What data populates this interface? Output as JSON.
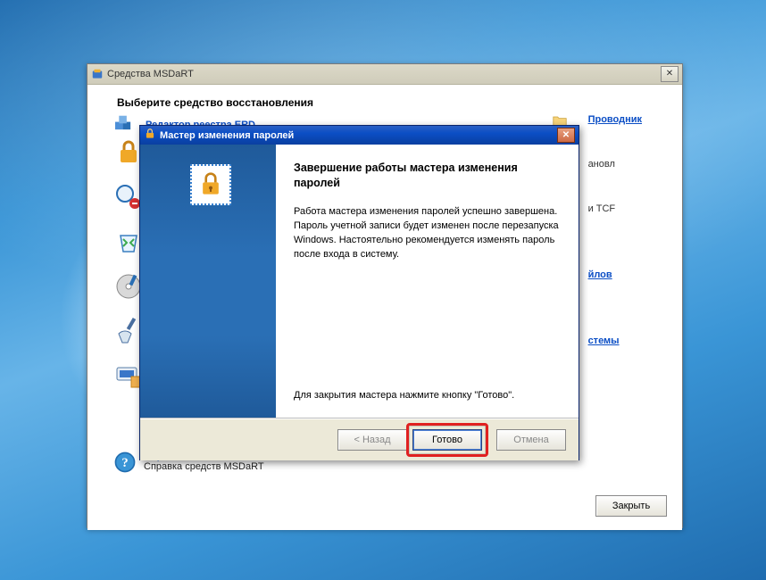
{
  "parent": {
    "title": "Средства MSDaRT",
    "heading": "Выберите средство восстановления",
    "tool_link": "Редактор реестра ERD",
    "right_link": "Проводник",
    "right_frag1": "ановл",
    "right_frag2": "и TCF",
    "right_frag3": "йлов",
    "right_frag4": "стемы",
    "help_link": "Справка",
    "help_desc": "Справка средств MSDaRT",
    "close_label": "Закрыть"
  },
  "wizard": {
    "title": "Мастер изменения паролей",
    "heading": "Завершение работы мастера изменения паролей",
    "paragraph": "Работа мастера изменения паролей успешно завершена. Пароль учетной записи будет изменен после перезапуска Windows. Настоятельно рекомендуется изменять пароль после входа в систему.",
    "hint": "Для закрытия мастера нажмите кнопку \"Готово\".",
    "back_label": "< Назад",
    "done_label": "Готово",
    "cancel_label": "Отмена"
  }
}
